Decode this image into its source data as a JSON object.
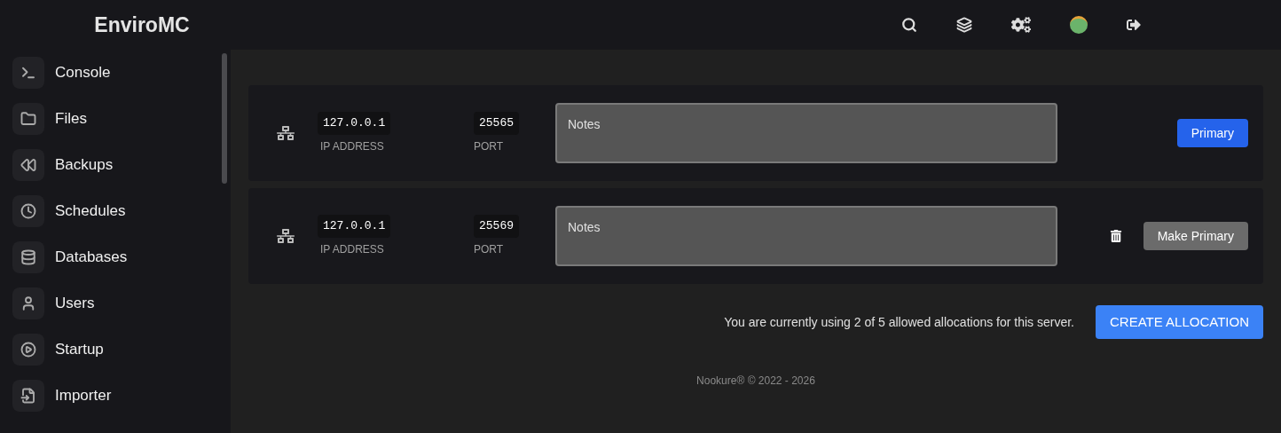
{
  "header": {
    "title": "EnviroMC"
  },
  "sidebar": {
    "items": [
      {
        "label": "Console"
      },
      {
        "label": "Files"
      },
      {
        "label": "Backups"
      },
      {
        "label": "Schedules"
      },
      {
        "label": "Databases"
      },
      {
        "label": "Users"
      },
      {
        "label": "Startup"
      },
      {
        "label": "Importer"
      }
    ]
  },
  "allocations": [
    {
      "ip": "127.0.0.1",
      "ip_label": "IP ADDRESS",
      "port": "25565",
      "port_label": "PORT",
      "notes_placeholder": "Notes",
      "primary": true,
      "action": "Primary"
    },
    {
      "ip": "127.0.0.1",
      "ip_label": "IP ADDRESS",
      "port": "25569",
      "port_label": "PORT",
      "notes_placeholder": "Notes",
      "primary": false,
      "action": "Make Primary"
    }
  ],
  "usage_text": "You are currently using 2 of 5 allowed allocations for this server.",
  "create_button": "CREATE ALLOCATION",
  "footer": "Nookure® © 2022 - 2026"
}
